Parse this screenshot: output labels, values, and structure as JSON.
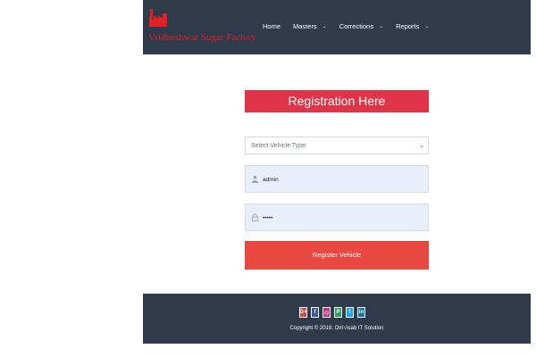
{
  "header": {
    "brand_name": "Vridheshwar Sugar Factory",
    "logo_icon": "factory-icon",
    "nav": [
      {
        "label": "Home",
        "has_dropdown": false
      },
      {
        "label": "Masters",
        "has_dropdown": true
      },
      {
        "label": "Corrections",
        "has_dropdown": true
      },
      {
        "label": "Reports",
        "has_dropdown": true
      }
    ]
  },
  "form": {
    "title": "Registration Here",
    "vehicle_type_placeholder": "Select Vehicle Type",
    "username_value": "admin",
    "password_value": "•••••",
    "submit_label": "Register Vehicle"
  },
  "footer": {
    "social": [
      {
        "name": "google-plus-icon",
        "glyph": "G+",
        "color": "#d34836"
      },
      {
        "name": "facebook-icon",
        "glyph": "f",
        "color": "#3b5998"
      },
      {
        "name": "instagram-icon",
        "glyph": "◎",
        "color": "#c13584"
      },
      {
        "name": "pinterest-icon",
        "glyph": "P",
        "color": "#2e9e5b"
      },
      {
        "name": "twitter-icon",
        "glyph": "t",
        "color": "#1da1f2"
      },
      {
        "name": "linkedin-icon",
        "glyph": "in",
        "color": "#0e76a8"
      }
    ],
    "copyright_prefix": "Copyright © 2019. Om",
    "copyright_highlight": "V",
    "copyright_suffix": "isab IT Solution"
  },
  "colors": {
    "header_bg": "#2f3a4b",
    "brand_red": "#e02222",
    "title_bg": "#e03448",
    "button_bg": "#e8483f",
    "field_bg": "#e8effb"
  }
}
